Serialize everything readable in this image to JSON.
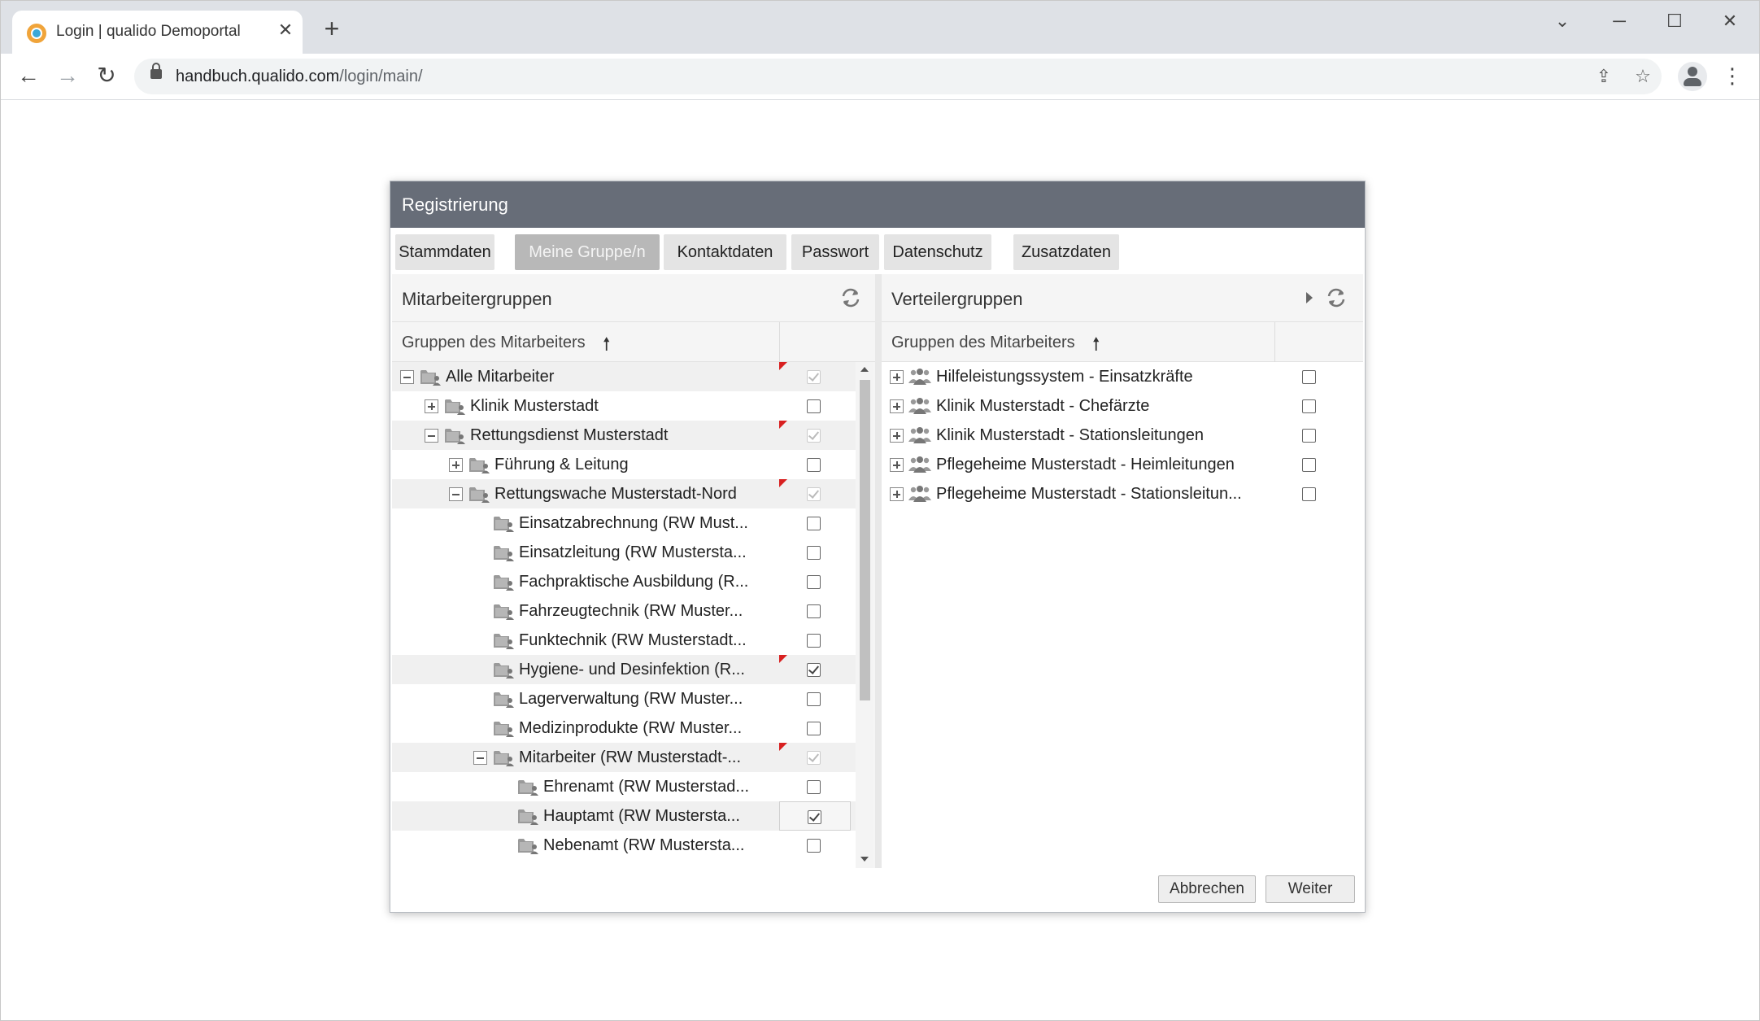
{
  "browser": {
    "tab_title": "Login | qualido Demoportal",
    "url_host": "handbuch.qualido.com",
    "url_path": "/login/main/"
  },
  "dialog": {
    "title": "Registrierung",
    "tabs": [
      {
        "label": "Stammdaten",
        "active": false
      },
      {
        "label": "Meine Gruppe/n",
        "active": true
      },
      {
        "label": "Kontaktdaten",
        "active": false
      },
      {
        "label": "Passwort",
        "active": false
      },
      {
        "label": "Datenschutz",
        "active": false
      },
      {
        "label": "Zusatzdaten",
        "active": false
      }
    ],
    "left_panel": {
      "title": "Mitarbeitergruppen",
      "column_label": "Gruppen des Mitarbeiters",
      "rows": [
        {
          "label": "Alle Mitarbeiter",
          "level": 0,
          "toggle": "minus",
          "flag": true,
          "checked": true,
          "disabled": true,
          "highlight": true
        },
        {
          "label": "Klinik Musterstadt",
          "level": 1,
          "toggle": "plus",
          "flag": false,
          "checked": false,
          "disabled": false,
          "highlight": false
        },
        {
          "label": "Rettungsdienst Musterstadt",
          "level": 1,
          "toggle": "minus",
          "flag": true,
          "checked": true,
          "disabled": true,
          "highlight": true
        },
        {
          "label": "Führung & Leitung",
          "level": 2,
          "toggle": "plus",
          "flag": false,
          "checked": false,
          "disabled": false,
          "highlight": false
        },
        {
          "label": "Rettungswache Musterstadt-Nord",
          "level": 2,
          "toggle": "minus",
          "flag": true,
          "checked": true,
          "disabled": true,
          "highlight": true
        },
        {
          "label": "Einsatzabrechnung (RW Must...",
          "level": 3,
          "toggle": "none",
          "flag": false,
          "checked": false,
          "disabled": false,
          "highlight": false
        },
        {
          "label": "Einsatzleitung (RW Mustersta...",
          "level": 3,
          "toggle": "none",
          "flag": false,
          "checked": false,
          "disabled": false,
          "highlight": false
        },
        {
          "label": "Fachpraktische Ausbildung (R...",
          "level": 3,
          "toggle": "none",
          "flag": false,
          "checked": false,
          "disabled": false,
          "highlight": false
        },
        {
          "label": "Fahrzeugtechnik (RW Muster...",
          "level": 3,
          "toggle": "none",
          "flag": false,
          "checked": false,
          "disabled": false,
          "highlight": false
        },
        {
          "label": "Funktechnik (RW Musterstadt...",
          "level": 3,
          "toggle": "none",
          "flag": false,
          "checked": false,
          "disabled": false,
          "highlight": false
        },
        {
          "label": "Hygiene- und Desinfektion (R...",
          "level": 3,
          "toggle": "none",
          "flag": true,
          "checked": true,
          "disabled": false,
          "highlight": true
        },
        {
          "label": "Lagerverwaltung (RW Muster...",
          "level": 3,
          "toggle": "none",
          "flag": false,
          "checked": false,
          "disabled": false,
          "highlight": false
        },
        {
          "label": "Medizinprodukte (RW Muster...",
          "level": 3,
          "toggle": "none",
          "flag": false,
          "checked": false,
          "disabled": false,
          "highlight": false
        },
        {
          "label": "Mitarbeiter (RW Musterstadt-...",
          "level": 3,
          "toggle": "minus",
          "flag": true,
          "checked": true,
          "disabled": true,
          "highlight": true
        },
        {
          "label": "Ehrenamt (RW Musterstad...",
          "level": 4,
          "toggle": "none",
          "flag": false,
          "checked": false,
          "disabled": false,
          "highlight": false
        },
        {
          "label": "Hauptamt (RW Mustersta...",
          "level": 4,
          "toggle": "none",
          "flag": true,
          "checked": true,
          "disabled": false,
          "highlight": true,
          "selected_cell": true
        },
        {
          "label": "Nebenamt (RW Mustersta...",
          "level": 4,
          "toggle": "none",
          "flag": false,
          "checked": false,
          "disabled": false,
          "highlight": false
        }
      ]
    },
    "right_panel": {
      "title": "Verteilergruppen",
      "column_label": "Gruppen des Mitarbeiters",
      "rows": [
        {
          "label": "Hilfeleistungssystem - Einsatzkräfte",
          "checked": false
        },
        {
          "label": "Klinik Musterstadt - Chefärzte",
          "checked": false
        },
        {
          "label": "Klinik Musterstadt - Stationsleitungen",
          "checked": false
        },
        {
          "label": "Pflegeheime Musterstadt - Heimleitungen",
          "checked": false
        },
        {
          "label": "Pflegeheime Musterstadt - Stationsleitun...",
          "checked": false
        }
      ]
    },
    "buttons": {
      "cancel": "Abbrechen",
      "next": "Weiter"
    }
  },
  "colors": {
    "dialog_header": "#676d78",
    "active_tab": "#b8b8b8",
    "flag": "#d82020"
  },
  "icons": [
    "refresh-icon",
    "folder-user-icon",
    "group-icon",
    "sort-up-arrow-icon"
  ]
}
